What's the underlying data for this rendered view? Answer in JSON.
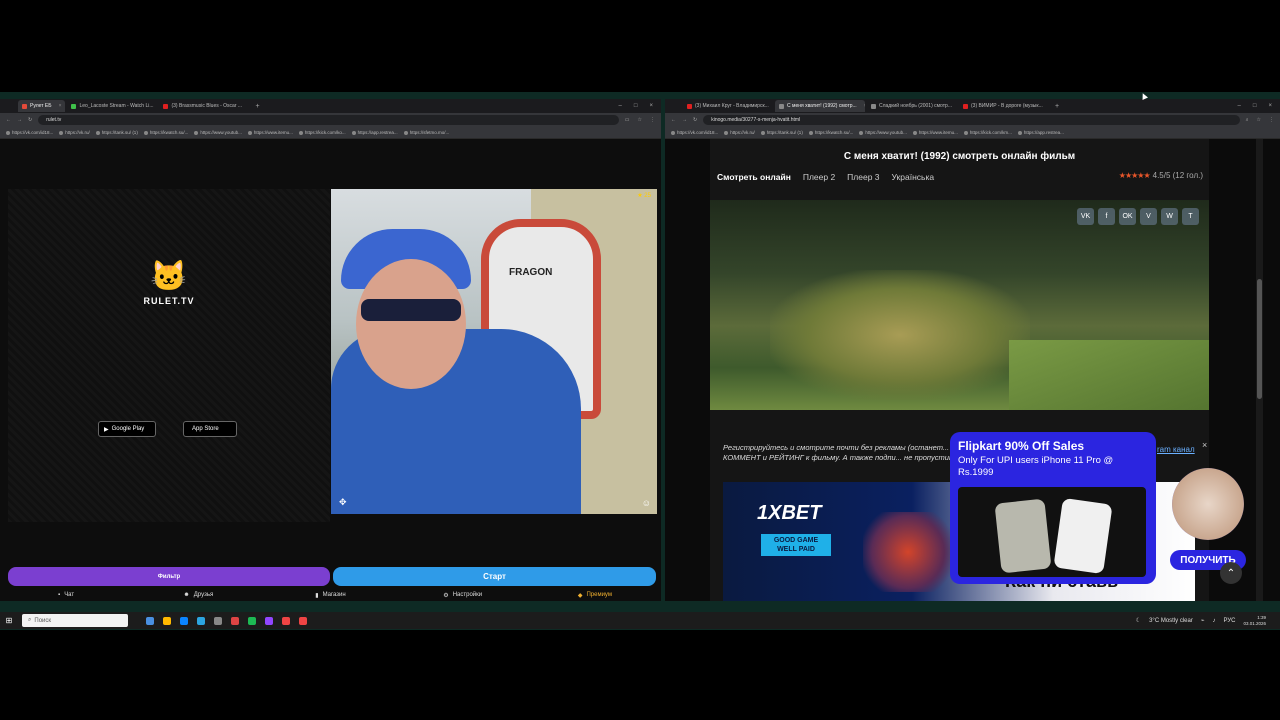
{
  "left_browser": {
    "tabs": [
      {
        "title": "Рулет ЕБ",
        "color": "#e24a3a",
        "active": true
      },
      {
        "title": "Leo_Lacoste Stream - Watch Li...",
        "color": "#3fc04a",
        "active": false
      },
      {
        "title": "(3) Brassmusic Blues - Oscar ...",
        "color": "#e02020",
        "active": false
      }
    ],
    "new_tab": "+",
    "url": "rulet.tv",
    "bookmarks": [
      "https://vk.com/id18...",
      "https://vk.ru/",
      "https://tank.su/ (1)",
      "https://kwatch.su/...",
      "https://www.youtub...",
      "https://www.itemu...",
      "https://kick.com/ko...",
      "https://app.restrea...",
      "https://sfetmo.mo/..."
    ]
  },
  "rulet": {
    "logo_text": "RULET.TV",
    "logo_icon": "cat-with-guns-icon",
    "google_play": "Google Play",
    "google_play_small": "GET IT ON",
    "app_store": "App Store",
    "app_store_small": "Download on the",
    "video_badge": "★ 25",
    "video_label_chair": "FRAGON",
    "filter_button": "Фильтр",
    "start_button": "Старт",
    "nav": [
      {
        "label": "Чат",
        "icon": "chat-icon"
      },
      {
        "label": "Друзья",
        "icon": "friends-icon"
      },
      {
        "label": "Магазин",
        "icon": "shop-icon"
      },
      {
        "label": "Настройки",
        "icon": "settings-icon"
      },
      {
        "label": "Премиум",
        "icon": "premium-icon"
      }
    ]
  },
  "right_browser": {
    "tabs": [
      {
        "title": "(3) Михаил Круг - Владимирск...",
        "color": "#e02020",
        "active": false
      },
      {
        "title": "С меня хватит! (1992) смотр...",
        "color": "#888888",
        "active": true
      },
      {
        "title": "Сладкий ноябрь (2001) смотр...",
        "color": "#888888",
        "active": false
      },
      {
        "title": "(3) ВИМИР - В дороге (музык...",
        "color": "#e02020",
        "active": false
      }
    ],
    "new_tab": "+",
    "url": "kinogo.media/30277-s-menja-hvatit.html",
    "bookmarks": [
      "https://vk.com/id18...",
      "https://vk.ru/",
      "https://tank.su/ (1)",
      "https://kwatch.su/...",
      "https://www.youtub...",
      "https://www.itemu...",
      "https://kick.com/km...",
      "https://app.restrea..."
    ]
  },
  "kinogo": {
    "title": "С меня хватит! (1992) смотреть онлайн фильм",
    "tabs": [
      "Смотреть онлайн",
      "Плеер 2",
      "Плеер 3",
      "Українська"
    ],
    "rating_stars": "★★★★★",
    "rating_text": "4.5/5 (12 гол.)",
    "share": [
      "VK",
      "f",
      "OK",
      "V",
      "W",
      "T"
    ],
    "notice": "Регистрируйтесь и смотрите почти без рекламы (останет... оставить КОММЕНТ и РЕЙТИНГ к фильму. А также подпи... не пропустить новости КиноГо.",
    "tg_link": "ram канал",
    "banner_brand": "1XBET",
    "banner_tagline": "GOOD GAME WELL PAID",
    "banner_slogan": "Как ни ставь"
  },
  "ad": {
    "title": "Flipkart 90% Off Sales",
    "subtitle": "Only For UPI users iPhone 11 Pro @ Rs.1999",
    "cta": "ПОЛУЧИТЬ",
    "close": "×"
  },
  "taskbar": {
    "search_placeholder": "Поиск",
    "weather": "3°C Mostly clear",
    "lang": "РУС",
    "time": "1:39",
    "date": "03.01.2026"
  }
}
